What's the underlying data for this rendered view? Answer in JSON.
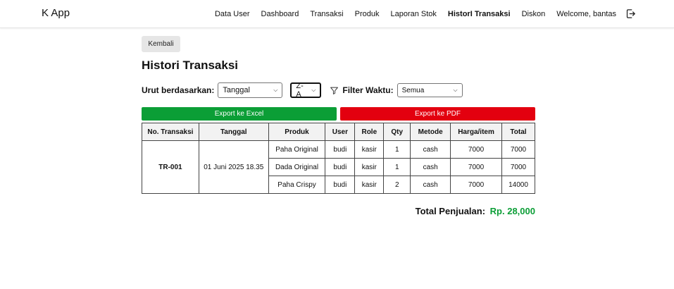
{
  "app": {
    "brand": "K App"
  },
  "nav": {
    "items": [
      "Data User",
      "Dashboard",
      "Transaksi",
      "Produk",
      "Laporan Stok",
      "HistorI Transaksi",
      "Diskon"
    ],
    "welcome": "Welcome, bantas",
    "active_index": 5
  },
  "page": {
    "back_label": "Kembali",
    "title": "Histori Transaksi"
  },
  "controls": {
    "sort_label": "Urut berdasarkan:",
    "sort_value": "Tanggal",
    "direction_value": "Z-A",
    "filter_label": "Filter Waktu:",
    "filter_value": "Semua"
  },
  "export": {
    "excel_label": "Export ke Excel",
    "pdf_label": "Export ke PDF"
  },
  "table": {
    "headers": [
      "No. Transaksi",
      "Tanggal",
      "Produk",
      "User",
      "Role",
      "Qty",
      "Metode",
      "Harga/item",
      "Total"
    ],
    "transaction": {
      "id": "TR-001",
      "date": "01 Juni 2025 18.35",
      "rows": [
        {
          "produk": "Paha Original",
          "user": "budi",
          "role": "kasir",
          "qty": "1",
          "metode": "cash",
          "harga": "7000",
          "total": "7000"
        },
        {
          "produk": "Dada Original",
          "user": "budi",
          "role": "kasir",
          "qty": "1",
          "metode": "cash",
          "harga": "7000",
          "total": "7000"
        },
        {
          "produk": "Paha Crispy",
          "user": "budi",
          "role": "kasir",
          "qty": "2",
          "metode": "cash",
          "harga": "7000",
          "total": "14000"
        }
      ]
    }
  },
  "summary": {
    "label": "Total Penjualan:",
    "value": "Rp. 28,000"
  },
  "colors": {
    "excel": "#0b9e36",
    "pdf": "#e3000f",
    "total": "#0b9e36"
  },
  "icons": {
    "logout": "logout-icon",
    "filter": "funnel-icon",
    "caret": "chevron-down-icon"
  }
}
